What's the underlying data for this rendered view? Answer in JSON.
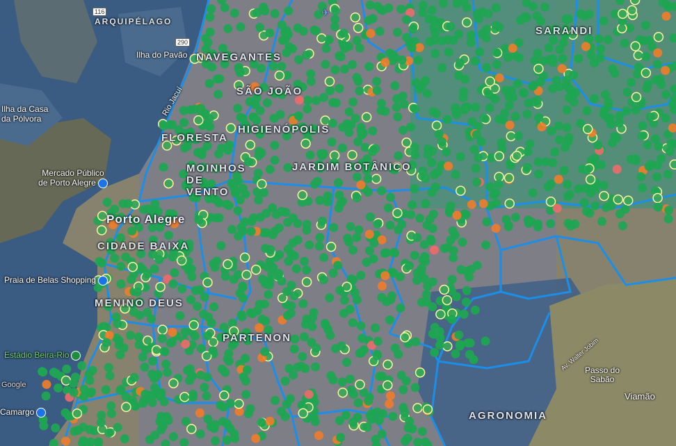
{
  "colors": {
    "water": "#3b5f86",
    "land": "#8a8a78",
    "urban": "#7e7f8a",
    "boundary": "#1b8ee8",
    "marker_green": "#1fa552",
    "marker_yellow": "#e8e02c",
    "marker_orange": "#f07d2a",
    "marker_red": "#f06a6a"
  },
  "labels": {
    "arquipelago": "ARQUIPÉLAGO",
    "ilha_pavao": "Ilha do Pavão",
    "rio_jacui": "Rio Jacuí",
    "ilha_casa_polvora": "Ilha da Casa da Pólvora",
    "navegantes": "NAVEGANTES",
    "sao_joao": "SÃO JOÃO",
    "higienopolis": "HIGIENÓPOLIS",
    "floresta": "FLORESTA",
    "mercado_publico": "Mercado Público de Porto Alegre",
    "moinhos_vento": "MOINHOS DE VENTO",
    "porto_alegre": "Porto Alegre",
    "cidade_baixa": "CIDADE BAIXA",
    "praia_belas": "Praia de Belas Shopping",
    "menino_deus": "MENINO DEUS",
    "estadio": "Estádio Beira-Rio",
    "camargo": "Camargo",
    "jardim_botanico": "JARDIM BOTÂNICO",
    "partenon": "PARTENON",
    "agronomia": "AGRONOMIA",
    "passo_sabao": "Passo do Sabão",
    "viamao": "Viamão",
    "av_walter_jobim": "Av. Walter Jobim",
    "sarandi": "SARANDI",
    "google": "Google"
  },
  "road_shields": {
    "br116": "116",
    "br290": "290"
  },
  "icons": {
    "airport": "airport-icon",
    "poi_market": "place-marker-icon",
    "poi_shopping": "shopping-icon",
    "poi_stadium": "stadium-icon",
    "poi_camargo": "place-marker-icon"
  }
}
